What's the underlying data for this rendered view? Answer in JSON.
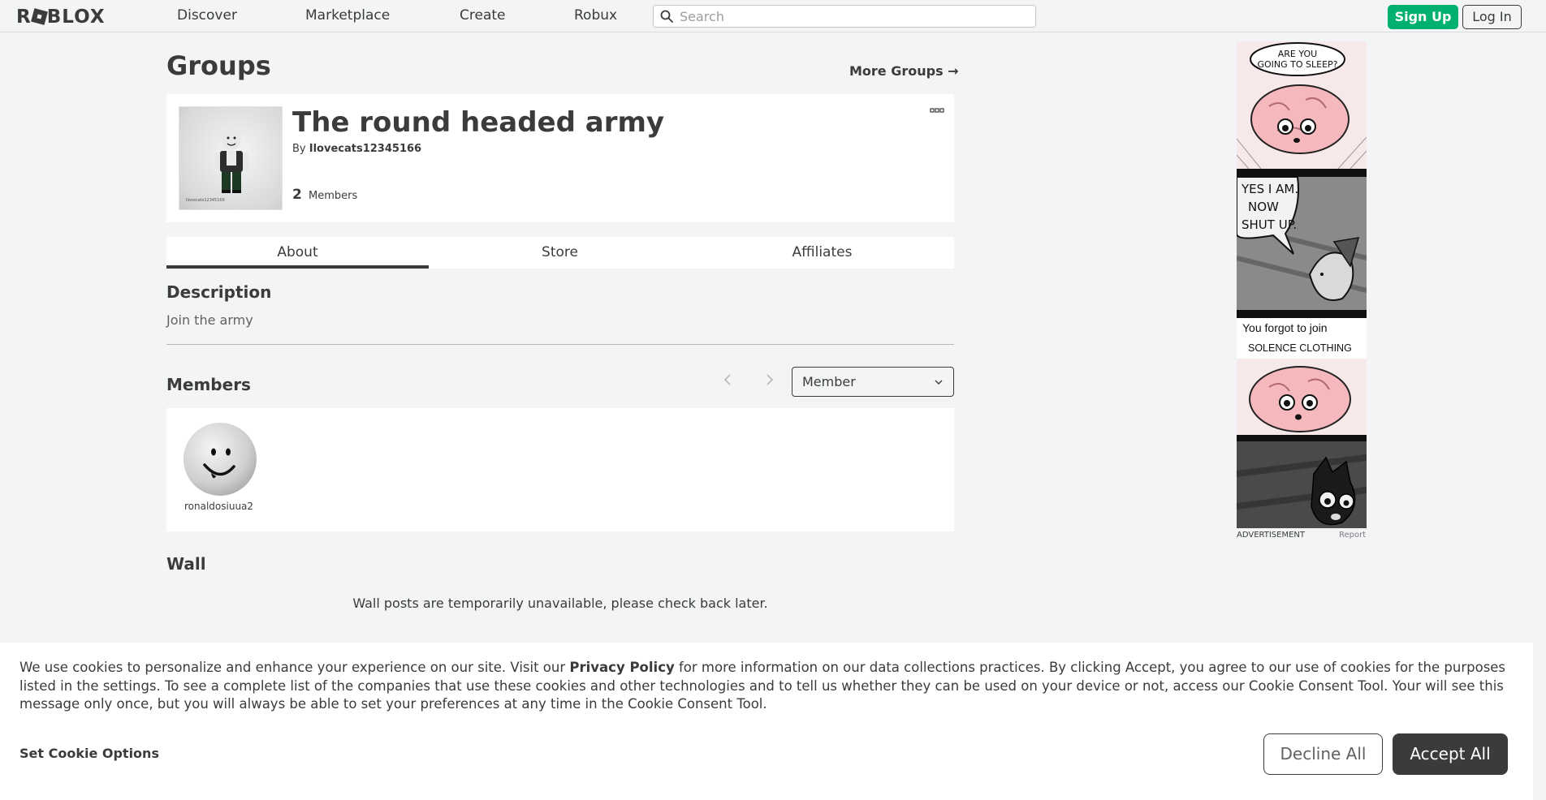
{
  "header": {
    "logo": "ROBLOX",
    "nav": [
      "Discover",
      "Marketplace",
      "Create",
      "Robux"
    ],
    "search_placeholder": "Search",
    "signup_label": "Sign Up",
    "login_label": "Log In"
  },
  "page": {
    "title": "Groups",
    "more_groups": "More Groups →"
  },
  "group": {
    "name": "The round headed army",
    "by_prefix": "By",
    "owner": "Ilovecats12345166",
    "thumb_caption": "Ilovecats12345166",
    "member_count": "2",
    "members_label": "Members"
  },
  "tabs": [
    "About",
    "Store",
    "Affiliates"
  ],
  "about": {
    "description_heading": "Description",
    "description": "Join the army",
    "members_heading": "Members",
    "role_filter": "Member",
    "members": [
      {
        "name": "ronaldosiuua2"
      }
    ],
    "wall_heading": "Wall",
    "wall_message": "Wall posts are temporarily unavailable, please check back later."
  },
  "ad": {
    "panel1_text": "ARE YOU GOING TO SLEEP?",
    "panel2_text": "YES I AM. NOW SHUT UP.",
    "panel3_line1": "You forgot to join",
    "panel3_line2": "SOLENCE CLOTHING",
    "label": "ADVERTISEMENT",
    "report": "Report"
  },
  "cookie": {
    "text_before": "We use cookies to personalize and enhance your experience on our site. Visit our ",
    "privacy_link": "Privacy Policy",
    "text_after": " for more information on our data collections practices. By clicking Accept, you agree to our use of cookies for the purposes listed in the settings. To see a complete list of the companies that use these cookies and other technologies and to tell us whether they can be used on your device or not, access our Cookie Consent Tool. Your will see this message only once, but you will always be able to set your preferences at any time in the Cookie Consent Tool.",
    "set_options": "Set Cookie Options",
    "decline": "Decline All",
    "accept": "Accept All"
  },
  "colors": {
    "background": "#f2f4f5",
    "text": "#393b3d",
    "signup_green": "#00b06f",
    "brain_pink": "#f4b8bd"
  }
}
